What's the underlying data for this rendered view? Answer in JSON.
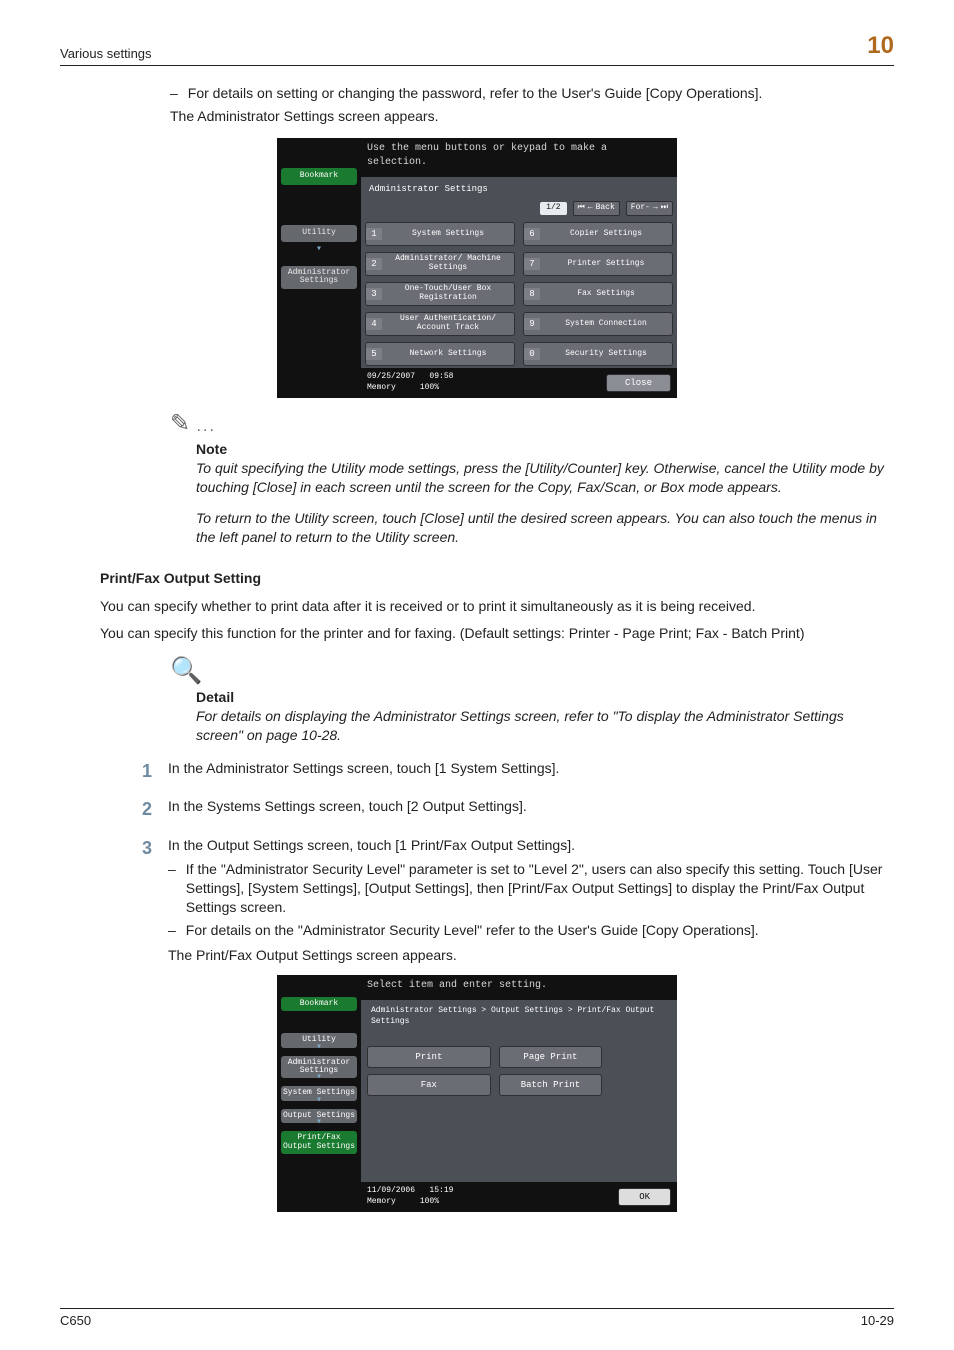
{
  "header": {
    "section": "Various settings",
    "chapter_number": "10"
  },
  "intro": {
    "bullet1": "For details on setting or changing the password, refer to the User's Guide [Copy Operations].",
    "line2": "The Administrator Settings screen appears."
  },
  "screenshot1": {
    "topline": "Use the menu buttons or keypad to make a selection.",
    "sidebar": {
      "bookmark": "Bookmark",
      "utility": "Utility",
      "admin": "Administrator Settings"
    },
    "title": "Administrator Settings",
    "pager": {
      "page": "1/2",
      "back": "Back",
      "fwd": ""
    },
    "left_items": [
      {
        "n": "1",
        "label": "System Settings"
      },
      {
        "n": "2",
        "label": "Administrator/\nMachine Settings"
      },
      {
        "n": "3",
        "label": "One-Touch/User Box\nRegistration"
      },
      {
        "n": "4",
        "label": "User Authentication/\nAccount Track"
      },
      {
        "n": "5",
        "label": "Network Settings"
      }
    ],
    "right_items": [
      {
        "n": "6",
        "label": "Copier Settings"
      },
      {
        "n": "7",
        "label": "Printer Settings"
      },
      {
        "n": "8",
        "label": "Fax Settings"
      },
      {
        "n": "9",
        "label": "System Connection"
      },
      {
        "n": "0",
        "label": "Security Settings"
      }
    ],
    "status": {
      "date": "09/25/2007",
      "time": "09:58",
      "mem_label": "Memory",
      "mem_val": "100%"
    },
    "close": "Close"
  },
  "note": {
    "label": "Note",
    "p1": "To quit specifying the Utility mode settings, press the [Utility/Counter] key. Otherwise, cancel the Utility mode by touching [Close] in each screen until the screen for the Copy, Fax/Scan, or Box mode appears.",
    "p2": "To return to the Utility screen, touch [Close] until the desired screen appears. You can also touch the menus in the left panel to return to the Utility screen."
  },
  "section2": {
    "heading": "Print/Fax Output Setting",
    "p1": "You can specify whether to print data after it is received or to print it simultaneously as it is being received.",
    "p2": "You can specify this function for the printer and for faxing. (Default settings: Printer - Page Print; Fax - Batch Print)"
  },
  "detail": {
    "label": "Detail",
    "p1": "For details on displaying the Administrator Settings screen, refer to \"To display the Administrator Settings screen\" on page 10-28."
  },
  "steps": {
    "s1": "In the Administrator Settings screen, touch [1 System Settings].",
    "s2": "In the Systems Settings screen, touch [2 Output Settings].",
    "s3": "In the Output Settings screen, touch [1 Print/Fax Output Settings].",
    "s3_b1": "If the \"Administrator Security Level\" parameter is set to \"Level 2\", users can also specify this setting. Touch [User Settings], [System Settings], [Output Settings], then [Print/Fax Output Settings] to display the Print/Fax Output Settings screen.",
    "s3_b2": "For details on the \"Administrator Security Level\" refer to the User's Guide [Copy Operations].",
    "s3_after": "The Print/Fax Output Settings screen appears."
  },
  "screenshot2": {
    "topline": "Select item and enter setting.",
    "sidebar": {
      "bookmark": "Bookmark",
      "utility": "Utility",
      "admin": "Administrator Settings",
      "system": "System Settings",
      "output": "Output Settings",
      "printfax": "Print/Fax Output Settings"
    },
    "title": "Administrator Settings > Output Settings > Print/Fax Output Settings",
    "rows": [
      {
        "left": "Print",
        "right": "Page Print"
      },
      {
        "left": "Fax",
        "right": "Batch Print"
      }
    ],
    "status": {
      "date": "11/09/2006",
      "time": "15:19",
      "mem_label": "Memory",
      "mem_val": "100%"
    },
    "ok": "OK"
  },
  "footer": {
    "left": "C650",
    "right": "10-29"
  }
}
